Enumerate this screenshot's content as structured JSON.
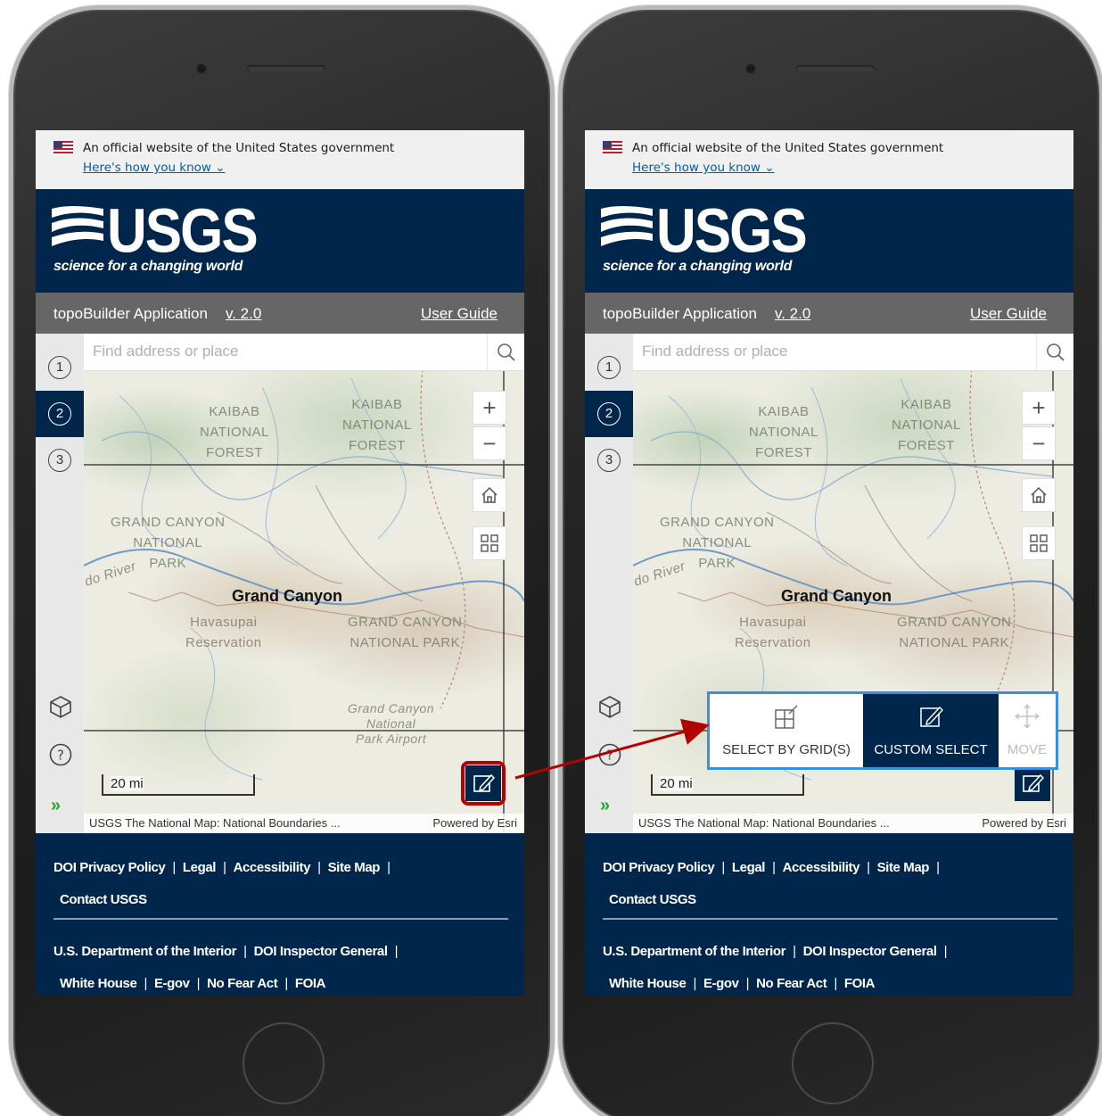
{
  "gov_banner": {
    "text": "An official website of the United States government",
    "link": "Here's how you know"
  },
  "header": {
    "logo_text": "USGS",
    "tagline": "science for a changing world"
  },
  "app_bar": {
    "title": "topoBuilder Application",
    "version": "v. 2.0",
    "guide": "User Guide"
  },
  "rail": {
    "steps": [
      "1",
      "2",
      "3"
    ],
    "active_step": "2"
  },
  "search": {
    "placeholder": "Find address or place"
  },
  "map": {
    "labels": {
      "kaibab_left": "KAIBAB\nNATIONAL\nFOREST",
      "kaibab_right": "KAIBAB\nNATIONAL\nFOREST",
      "gc_park": "GRAND CANYON\nNATIONAL\nPARK",
      "gc_park_right": "GRAND CANYON\nNATIONAL PARK",
      "havasupai": "Havasupai\nReservation",
      "airport": "Grand Canyon\nNational\nPark Airport",
      "river": "do River",
      "city": "Grand Canyon"
    },
    "zoom_in": "+",
    "zoom_out": "−",
    "scale": "20 mi",
    "attribution": "USGS The National Map: National Boundaries ...",
    "powered_by": "Powered by Esri"
  },
  "footer": {
    "row1": [
      "DOI Privacy Policy",
      "Legal",
      "Accessibility",
      "Site Map"
    ],
    "contact": "Contact USGS",
    "row2": [
      "U.S. Department of the Interior",
      "DOI Inspector General"
    ],
    "row3": [
      "White House",
      "E-gov",
      "No Fear Act",
      "FOIA"
    ]
  },
  "popup": {
    "select_grid": "SELECT BY GRID(S)",
    "custom_select": "CUSTOM SELECT",
    "move": "MOVE"
  },
  "colors": {
    "usgs_navy": "#00264c",
    "highlight_red": "#b30000",
    "popup_border": "#3a8fe0"
  }
}
